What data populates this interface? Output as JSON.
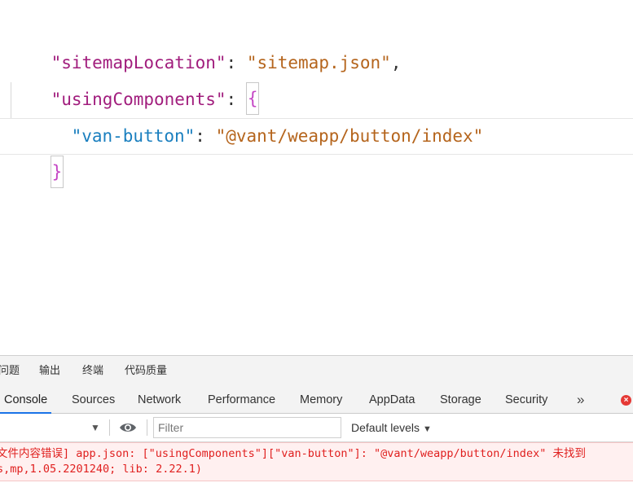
{
  "editor": {
    "line1": {
      "key": "\"sitemapLocation\"",
      "colon": ": ",
      "value": "\"sitemap.json\"",
      "comma": ","
    },
    "line2": {
      "key": "\"usingComponents\"",
      "colon": ": ",
      "brace_open": "{"
    },
    "line3": {
      "key": "\"van-button\"",
      "colon": ": ",
      "value": "\"@vant/weapp/button/index\""
    },
    "line4": {
      "brace_close": "}"
    }
  },
  "devtools": {
    "panel_tabs": [
      "问题",
      "输出",
      "终端",
      "代码质量"
    ],
    "tool_tabs": [
      "Console",
      "Sources",
      "Network",
      "Performance",
      "Memory",
      "AppData",
      "Storage",
      "Security"
    ],
    "active_tool_tab": "Console",
    "more_label": "»",
    "error_badge": "×",
    "filter_placeholder": "Filter",
    "default_levels": "Default levels",
    "messages": {
      "line1": "文件内容错误] app.json: [\"usingComponents\"][\"van-button\"]: \"@vant/weapp/button/index\" 未找到",
      "line2": "s,mp,1.05.2201240; lib: 2.22.1)"
    }
  },
  "colors": {
    "accent": "#1a73e8",
    "error": "#e0201f",
    "root_key": "#a11d7d",
    "child_key": "#1a7fbf",
    "string": "#b5651d"
  }
}
